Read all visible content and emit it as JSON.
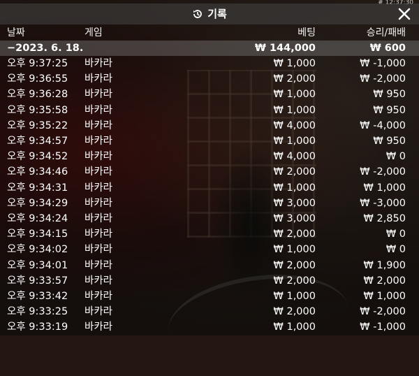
{
  "clock": "# 12:37:30",
  "title": "기록",
  "header": {
    "date": "날짜",
    "game": "게임",
    "bet": "베팅",
    "result": "승리/패배"
  },
  "summary": {
    "date": "−2023. 6. 18.",
    "bet": "₩ 144,000",
    "result": "₩ 600"
  },
  "rows": [
    {
      "time": "오후 9:37:25",
      "game": "바카라",
      "bet": "₩ 1,000",
      "result": "₩ -1,000"
    },
    {
      "time": "오후 9:36:55",
      "game": "바카라",
      "bet": "₩ 2,000",
      "result": "₩ -2,000"
    },
    {
      "time": "오후 9:36:28",
      "game": "바카라",
      "bet": "₩ 1,000",
      "result": "₩ 950"
    },
    {
      "time": "오후 9:35:58",
      "game": "바카라",
      "bet": "₩ 1,000",
      "result": "₩ 950"
    },
    {
      "time": "오후 9:35:22",
      "game": "바카라",
      "bet": "₩ 4,000",
      "result": "₩ -4,000"
    },
    {
      "time": "오후 9:34:57",
      "game": "바카라",
      "bet": "₩ 1,000",
      "result": "₩ 950"
    },
    {
      "time": "오후 9:34:52",
      "game": "바카라",
      "bet": "₩ 4,000",
      "result": "₩ 0"
    },
    {
      "time": "오후 9:34:46",
      "game": "바카라",
      "bet": "₩ 2,000",
      "result": "₩ -2,000"
    },
    {
      "time": "오후 9:34:31",
      "game": "바카라",
      "bet": "₩ 1,000",
      "result": "₩ 1,000"
    },
    {
      "time": "오후 9:34:29",
      "game": "바카라",
      "bet": "₩ 3,000",
      "result": "₩ -3,000"
    },
    {
      "time": "오후 9:34:24",
      "game": "바카라",
      "bet": "₩ 3,000",
      "result": "₩ 2,850"
    },
    {
      "time": "오후 9:34:15",
      "game": "바카라",
      "bet": "₩ 2,000",
      "result": "₩ 0"
    },
    {
      "time": "오후 9:34:02",
      "game": "바카라",
      "bet": "₩ 1,000",
      "result": "₩ 0"
    },
    {
      "time": "오후 9:34:01",
      "game": "바카라",
      "bet": "₩ 2,000",
      "result": "₩ 1,900"
    },
    {
      "time": "오후 9:33:57",
      "game": "바카라",
      "bet": "₩ 2,000",
      "result": "₩ 2,000"
    },
    {
      "time": "오후 9:33:42",
      "game": "바카라",
      "bet": "₩ 1,000",
      "result": "₩ 1,000"
    },
    {
      "time": "오후 9:33:25",
      "game": "바카라",
      "bet": "₩ 2,000",
      "result": "₩ -2,000"
    },
    {
      "time": "오후 9:33:19",
      "game": "바카라",
      "bet": "₩ 1,000",
      "result": "₩ -1,000"
    }
  ],
  "icons": {
    "title": "history-icon",
    "close": "close-icon"
  }
}
